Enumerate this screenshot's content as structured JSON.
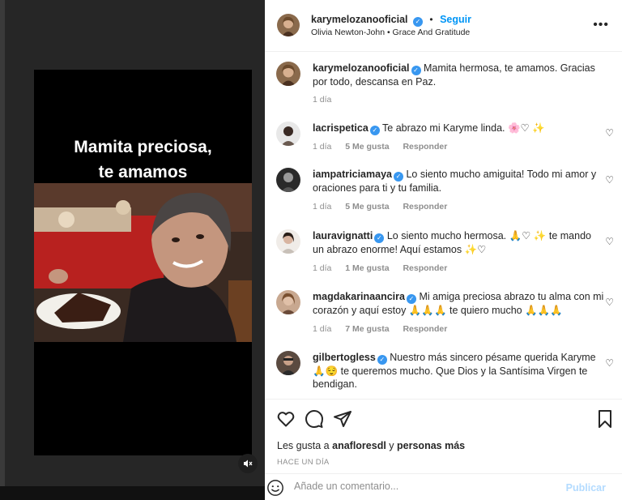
{
  "post": {
    "caption_overlay_line1": "Mamita preciosa,",
    "caption_overlay_line2": "te amamos"
  },
  "header": {
    "username": "karymelozanooficial",
    "separator": "•",
    "follow_label": "Seguir",
    "audio": "Olivia Newton-John • Grace And Gratitude",
    "more_icon": "more-horizontal-icon"
  },
  "caption": {
    "username": "karymelozanooficial",
    "text": "Mamita hermosa, te amamos. Gracias por todo, descansa en Paz.",
    "time": "1 día"
  },
  "comments": [
    {
      "username": "lacrispetica",
      "text": "Te abrazo mi Karyme linda. 🌸♡ ✨",
      "time": "1 día",
      "likes": "5 Me gusta",
      "reply": "Responder"
    },
    {
      "username": "iampatriciamaya",
      "text": "Lo siento mucho amiguita! Todo mi amor y oraciones para ti y tu familia.",
      "time": "1 día",
      "likes": "5 Me gusta",
      "reply": "Responder"
    },
    {
      "username": "lauravignatti",
      "text": "Lo siento mucho hermosa. 🙏♡ ✨ te mando un abrazo enorme! Aquí estamos ✨♡",
      "time": "1 día",
      "likes": "1 Me gusta",
      "reply": "Responder"
    },
    {
      "username": "magdakarinaancira",
      "text": "Mi amiga preciosa abrazo tu alma con mi corazón y aquí estoy 🙏🙏🙏 te quiero mucho 🙏🙏🙏",
      "time": "1 día",
      "likes": "7 Me gusta",
      "reply": "Responder"
    },
    {
      "username": "gilbertogless",
      "text": "Nuestro más sincero pésame querida Karyme 🙏😌 te queremos mucho. Que Dios y la Santísima Virgen te bendigan.",
      "time": "",
      "likes": "",
      "reply": ""
    }
  ],
  "actions": {
    "likes_prefix": "Les gusta a",
    "likes_user": "anafloresdl",
    "likes_conj": "y",
    "likes_rest": "personas más",
    "time_ago": "HACE UN DÍA"
  },
  "add_comment": {
    "placeholder": "Añade un comentario...",
    "publish_label": "Publicar"
  },
  "colors": {
    "accent": "#0095f6",
    "verified": "#3897f0",
    "muted": "#8e8e8e",
    "publish_disabled": "#b3dbff"
  }
}
